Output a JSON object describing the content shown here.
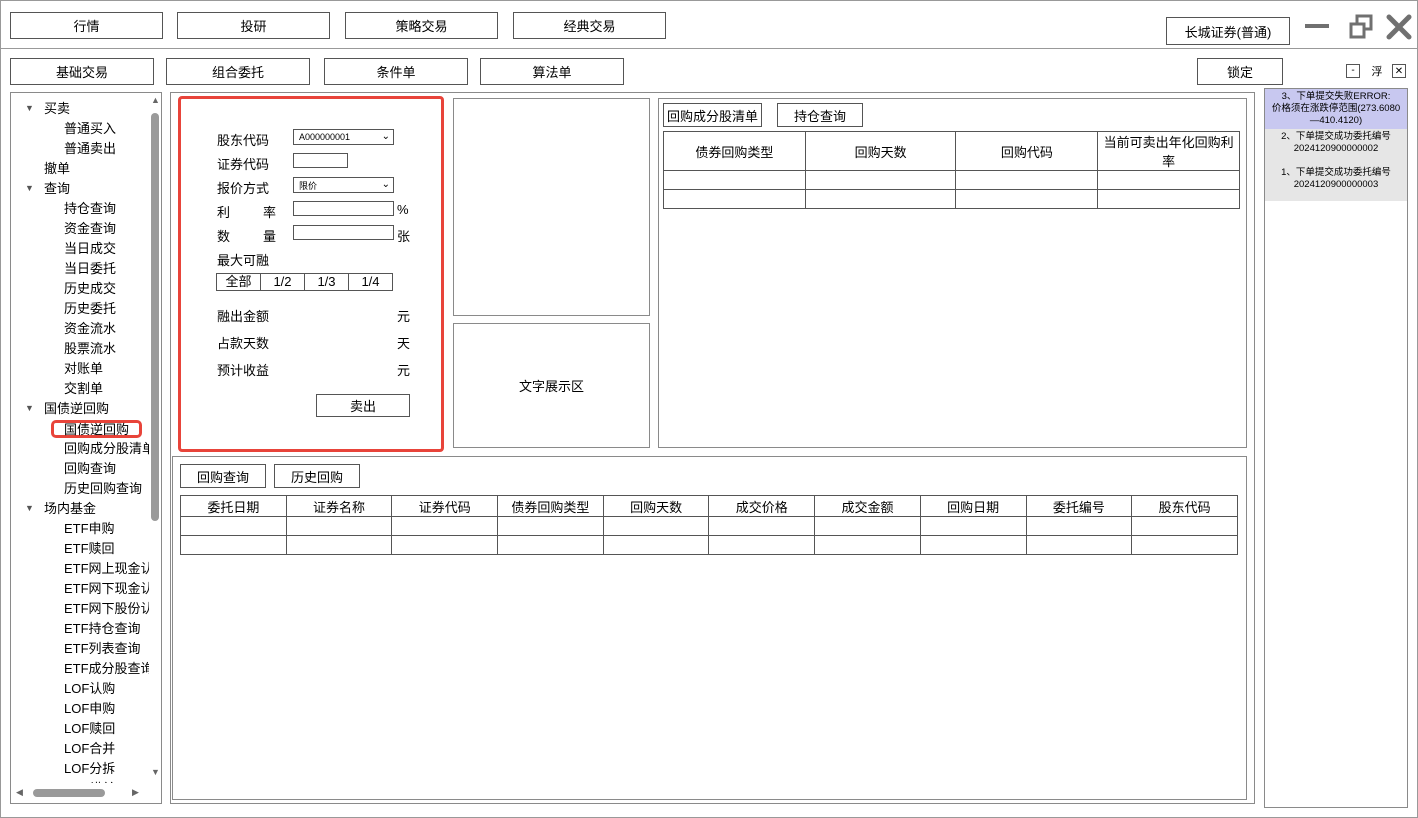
{
  "top_nav": [
    "行情",
    "投研",
    "策略交易",
    "经典交易"
  ],
  "account": "长城证券(普通)",
  "sub_nav": [
    "基础交易",
    "组合委托",
    "条件单",
    "算法单"
  ],
  "lock_label": "锁定",
  "float_label": "浮",
  "tree": [
    {
      "label": "买卖",
      "level": 0,
      "expanded": true
    },
    {
      "label": "普通买入",
      "level": 1
    },
    {
      "label": "普通卖出",
      "level": 1
    },
    {
      "label": "撤单",
      "level": 0
    },
    {
      "label": "查询",
      "level": 0,
      "expanded": true
    },
    {
      "label": "持仓查询",
      "level": 1
    },
    {
      "label": "资金查询",
      "level": 1
    },
    {
      "label": "当日成交",
      "level": 1
    },
    {
      "label": "当日委托",
      "level": 1
    },
    {
      "label": "历史成交",
      "level": 1
    },
    {
      "label": "历史委托",
      "level": 1
    },
    {
      "label": "资金流水",
      "level": 1
    },
    {
      "label": "股票流水",
      "level": 1
    },
    {
      "label": "对账单",
      "level": 1
    },
    {
      "label": "交割单",
      "level": 1
    },
    {
      "label": "国债逆回购",
      "level": 0,
      "expanded": true
    },
    {
      "label": "国债逆回购",
      "level": 1,
      "selected": true
    },
    {
      "label": "回购成分股清单",
      "level": 1
    },
    {
      "label": "回购查询",
      "level": 1
    },
    {
      "label": "历史回购查询",
      "level": 1
    },
    {
      "label": "场内基金",
      "level": 0,
      "expanded": true
    },
    {
      "label": "ETF申购",
      "level": 1
    },
    {
      "label": "ETF赎回",
      "level": 1
    },
    {
      "label": "ETF网上现金认",
      "level": 1
    },
    {
      "label": "ETF网下现金认",
      "level": 1
    },
    {
      "label": "ETF网下股份认",
      "level": 1
    },
    {
      "label": "ETF持仓查询",
      "level": 1
    },
    {
      "label": "ETF列表查询",
      "level": 1
    },
    {
      "label": "ETF成分股查询",
      "level": 1
    },
    {
      "label": "LOF认购",
      "level": 1
    },
    {
      "label": "LOF申购",
      "level": 1
    },
    {
      "label": "LOF赎回",
      "level": 1
    },
    {
      "label": "LOF合并",
      "level": 1
    },
    {
      "label": "LOF分拆",
      "level": 1
    },
    {
      "label": "LOF横并",
      "level": 1
    }
  ],
  "form": {
    "holder_code_label": "股东代码",
    "holder_code_value": "A000000001",
    "security_code_label": "证券代码",
    "security_code_value": "",
    "quote_method_label": "报价方式",
    "quote_method_value": "限价",
    "rate_label": "利　率",
    "rate_value": "",
    "rate_unit": "%",
    "qty_label": "数　量",
    "qty_value": "",
    "qty_unit": "张",
    "max_label": "最大可融",
    "fractions": [
      "全部",
      "1/2",
      "1/3",
      "1/4"
    ],
    "amount_label": "融出金额",
    "amount_unit": "元",
    "days_label": "占款天数",
    "days_unit": "天",
    "income_label": "预计收益",
    "income_unit": "元",
    "sell_label": "卖出"
  },
  "text_area_label": "文字展示区",
  "right_panel": {
    "tabs": [
      "回购成分股清单",
      "持仓查询"
    ],
    "headers": [
      "债券回购类型",
      "回购天数",
      "回购代码",
      "当前可卖出年化回购利率"
    ]
  },
  "bottom_panel": {
    "tabs": [
      "回购查询",
      "历史回购"
    ],
    "headers": [
      "委托日期",
      "证券名称",
      "证券代码",
      "债券回购类型",
      "回购天数",
      "成交价格",
      "成交金额",
      "回购日期",
      "委托编号",
      "股东代码"
    ]
  },
  "messages": [
    {
      "text1": "3、下单提交失败ERROR:",
      "text2": "价格须在涨跌停范围(273.6080",
      "text3": "—410.4120)",
      "highlight": true
    },
    {
      "text1": "2、下单提交成功委托编号",
      "text2": "2024120900000002",
      "text3": "",
      "highlight": false
    },
    {
      "text1": "1、下单提交成功委托编号",
      "text2": "2024120900000003",
      "text3": "",
      "highlight": false
    }
  ],
  "colors": {
    "highlight_red": "#e8443a",
    "message_highlight_bg": "#c8c8f0",
    "message_bg": "#e6e6e6"
  }
}
